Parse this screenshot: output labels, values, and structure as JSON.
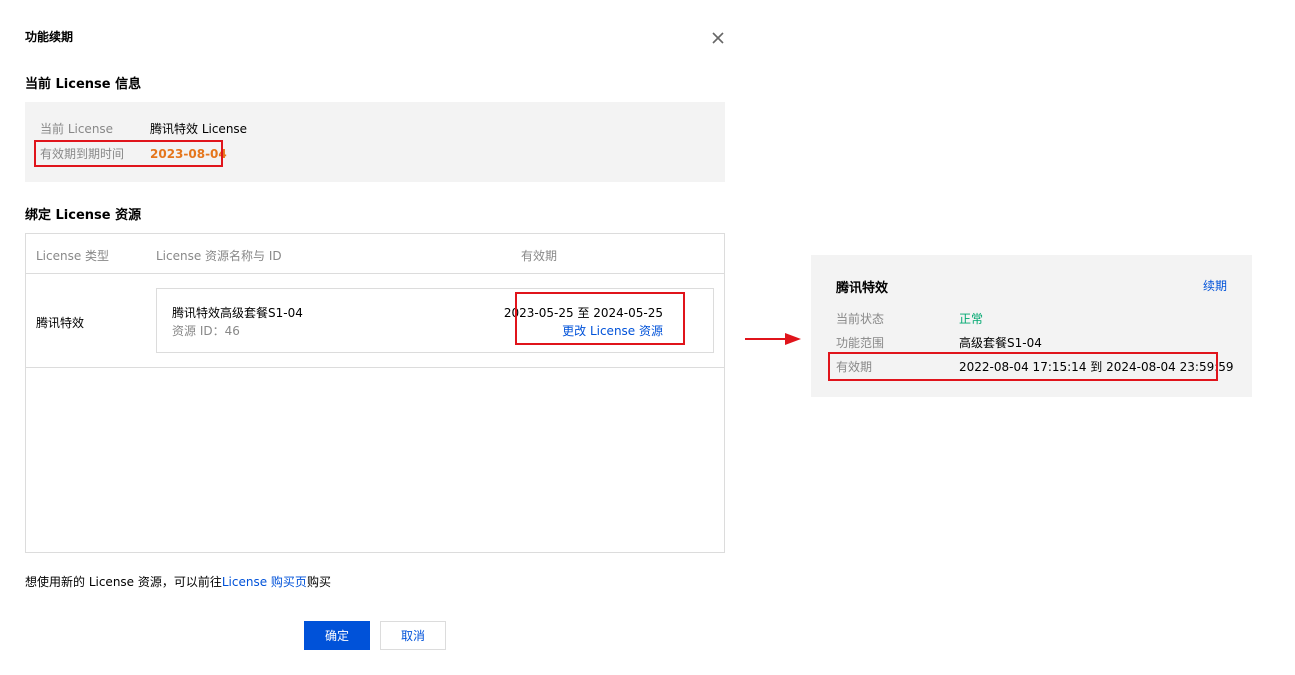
{
  "dialog": {
    "title": "功能续期",
    "close_icon": "close-icon"
  },
  "current_license": {
    "section_title": "当前 License 信息",
    "license_label": "当前 License",
    "license_value": "腾讯特效 License",
    "expiry_label": "有效期到期时间",
    "expiry_value": "2023-08-04"
  },
  "bind_resource": {
    "section_title": "绑定 License 资源",
    "columns": [
      "License 类型",
      "License 资源名称与 ID",
      "有效期"
    ],
    "rows": [
      {
        "type": "腾讯特效",
        "resource_name": "腾讯特效高级套餐S1-04",
        "resource_id": "资源 ID：46",
        "period": "2023-05-25 至 2024-05-25",
        "change_link": "更改 License 资源"
      }
    ]
  },
  "footer": {
    "note_prefix": "想使用新的 License 资源，可以前往",
    "note_link": "License 购买页",
    "note_suffix": "购买"
  },
  "buttons": {
    "confirm": "确定",
    "cancel": "取消"
  },
  "side_panel": {
    "title": "腾讯特效",
    "renew_link": "续期",
    "status_label": "当前状态",
    "status_value": "正常",
    "scope_label": "功能范围",
    "scope_value": "高级套餐S1-04",
    "period_label": "有效期",
    "period_value": "2022-08-04 17:15:14 到 2024-08-04 23:59:59"
  },
  "colors": {
    "accent": "#0052d9",
    "highlight": "#e0141b",
    "expiry": "#e5761c",
    "status_ok": "#00a870"
  }
}
